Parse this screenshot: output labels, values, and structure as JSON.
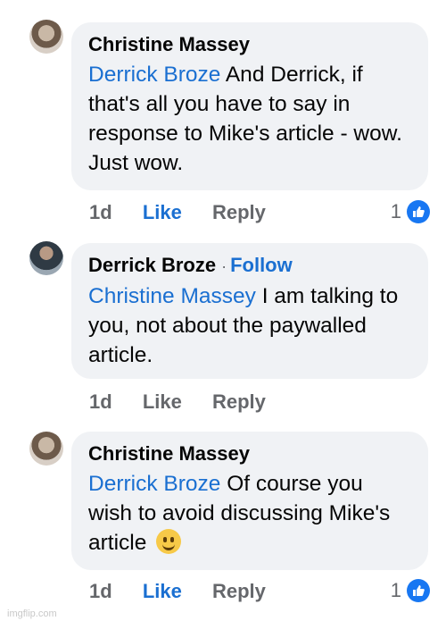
{
  "comments": [
    {
      "author": "Christine Massey",
      "mention": "Derrick Broze",
      "text": " And Derrick, if that's all you have to say in response to Mike's article - wow.  Just wow.",
      "time": "1d",
      "like_label": "Like",
      "reply_label": "Reply",
      "reaction_count": "1",
      "liked_by_viewer": true
    },
    {
      "author": "Derrick Broze",
      "separator": "·",
      "follow_label": "Follow",
      "mention": "Christine Massey",
      "text": " I am talking to you, not about the paywalled article.",
      "time": "1d",
      "like_label": "Like",
      "reply_label": "Reply"
    },
    {
      "author": "Christine Massey",
      "mention": "Derrick Broze",
      "text": " Of course you wish to avoid discussing Mike's article ",
      "emoji": "slightly-smiling-face",
      "time": "1d",
      "like_label": "Like",
      "reply_label": "Reply",
      "reaction_count": "1",
      "liked_by_viewer": true
    }
  ],
  "watermark": "imgflip.com",
  "colors": {
    "bubble": "#f0f2f5",
    "link": "#1a6fd1",
    "muted": "#65676b",
    "like_badge": "#1877f2"
  }
}
